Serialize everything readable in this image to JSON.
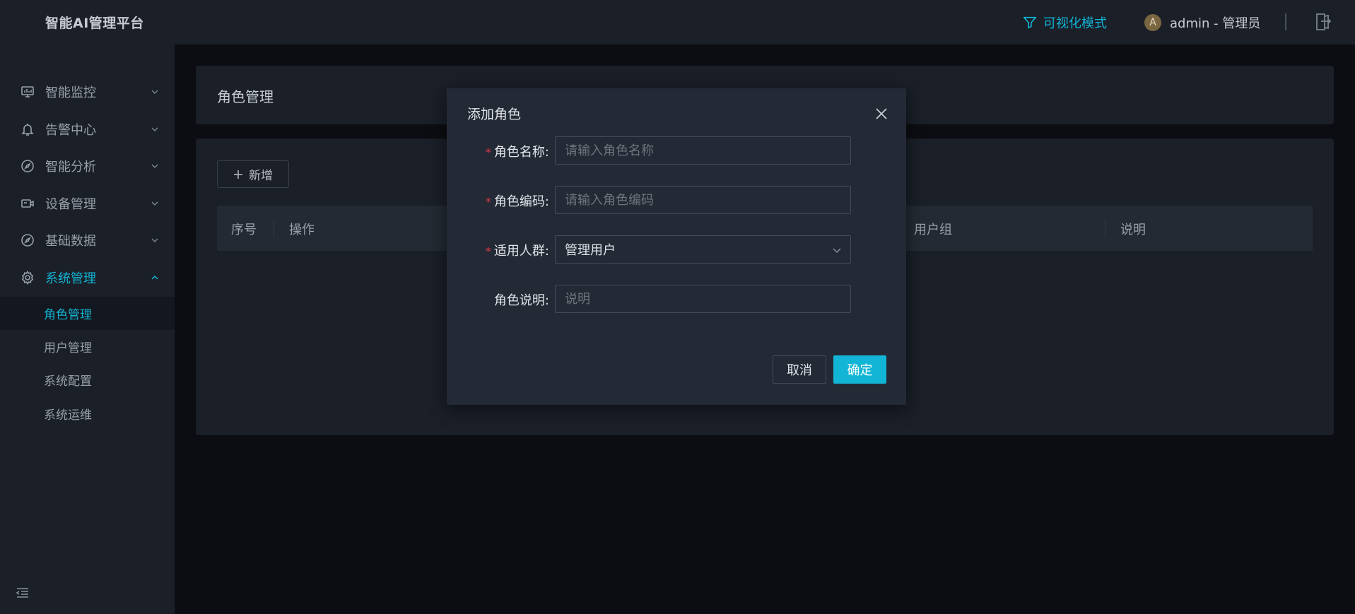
{
  "header": {
    "logo": "智能AI管理平台",
    "viz_mode": "可视化模式",
    "avatar_letter": "A",
    "user": "admin - 管理员"
  },
  "sidebar": {
    "items": [
      {
        "label": "智能监控",
        "icon": "monitor-icon"
      },
      {
        "label": "告警中心",
        "icon": "bell-icon"
      },
      {
        "label": "智能分析",
        "icon": "compass-icon"
      },
      {
        "label": "设备管理",
        "icon": "camera-icon"
      },
      {
        "label": "基础数据",
        "icon": "compass-icon"
      },
      {
        "label": "系统管理",
        "icon": "gear-icon",
        "expanded": true
      }
    ],
    "sub_items": [
      {
        "label": "角色管理",
        "selected": true
      },
      {
        "label": "用户管理"
      },
      {
        "label": "系统配置"
      },
      {
        "label": "系统运维"
      }
    ]
  },
  "page": {
    "title": "角色管理",
    "add_button": "新增",
    "table_headers": [
      "序号",
      "操作",
      "用户组",
      "说明"
    ]
  },
  "modal": {
    "title": "添加角色",
    "fields": {
      "role_name": {
        "label": "角色名称:",
        "placeholder": "请输入角色名称",
        "required": true
      },
      "role_code": {
        "label": "角色编码:",
        "placeholder": "请输入角色编码",
        "required": true
      },
      "audience": {
        "label": "适用人群:",
        "value": "管理用户",
        "required": true
      },
      "description": {
        "label": "角色说明:",
        "placeholder": "说明",
        "required": false
      }
    },
    "cancel": "取消",
    "confirm": "确定"
  },
  "colors": {
    "accent": "#13b5d6",
    "required": "#e0384a",
    "panel": "#1a1f28",
    "modal": "#242a35"
  }
}
